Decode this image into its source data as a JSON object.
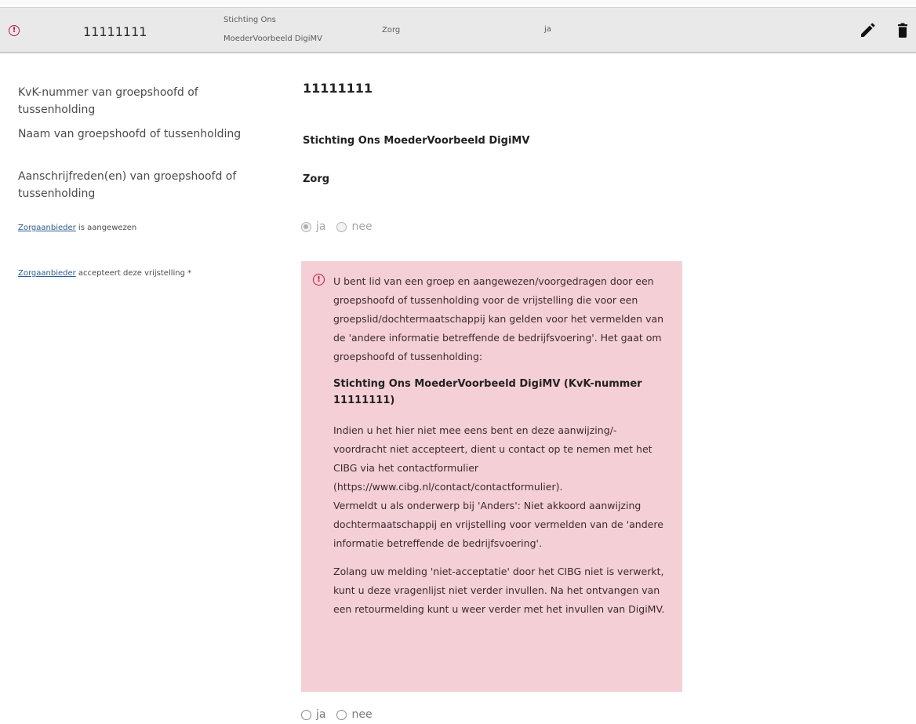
{
  "row": {
    "kvk": "11111111",
    "name_line1": "Stichting Ons",
    "name_line2": "MoederVoorbeeld DigiMV",
    "sector": "Zorg",
    "appointed": "ja"
  },
  "details": {
    "kvk_label": "KvK-nummer van groepshoofd of tussenholding",
    "kvk_value": "11111111",
    "name_label": "Naam van groepshoofd of tussenholding",
    "name_value": "Stichting Ons MoederVoorbeeld DigiMV",
    "reasons_label": "Aanschrijfreden(en) van groepshoofd of tussenholding",
    "reasons_value": "Zorg",
    "appointed_link": "Zorgaanbieder",
    "appointed_rest": " is aangewezen",
    "accepts_link": "Zorgaanbieder",
    "accepts_rest": " accepteert deze vrijstelling *"
  },
  "radios": {
    "yes": "ja",
    "no": "nee"
  },
  "alert": {
    "p1": "U bent lid van een groep en aangewezen/voorgedragen door een groepshoofd of tussenholding voor de vrijstelling die voor een groepslid/dochtermaatschappij kan gelden voor het vermelden van de 'andere informatie betreffende de bedrijfsvoering'. Het gaat om groepshoofd of tussenholding:",
    "p2": "Stichting Ons MoederVoorbeeld DigiMV (KvK-nummer 11111111)",
    "p3": "Indien u het hier niet mee eens bent en deze aanwijzing/-voordracht niet accepteert, dient u contact op te nemen met het CIBG via het contactformulier (https://www.cibg.nl/contact/contactformulier).",
    "p3b": "Vermeldt u als onderwerp bij 'Anders': Niet akkoord aanwijzing dochtermaatschappij en vrijstelling voor vermelden van de 'andere informatie betreffende de bedrijfsvoering'.",
    "p4": "Zolang uw melding 'niet-acceptatie' door het CIBG niet is verwerkt, kunt u deze vragenlijst niet verder invullen. Na het ontvangen van een retourmelding kunt u weer verder met het invullen van DigiMV."
  },
  "icons": {
    "alert": "exclamation-circle-icon",
    "edit": "pencil-icon",
    "delete": "trash-icon"
  },
  "colors": {
    "alert_red": "#c4163b",
    "alert_bg": "#f4cfd6",
    "link": "#2a5d93"
  }
}
